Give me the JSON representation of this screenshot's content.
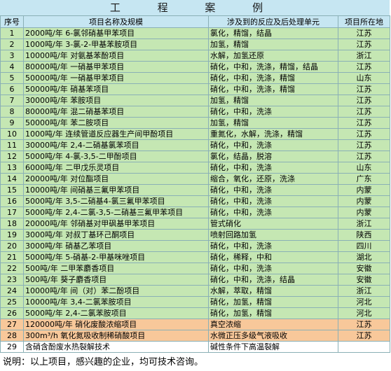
{
  "title": "工 程 案 例",
  "headers": {
    "no": "序号",
    "name": "项目名称及规模",
    "process": "涉及到的反应及后处理单元",
    "region": "项目所在地"
  },
  "rows": [
    {
      "no": "1",
      "name": "2000吨/年 6-氯邻硝基甲苯项目",
      "process": "氯化，精馏，结晶",
      "region": "江苏",
      "color": "green"
    },
    {
      "no": "2",
      "name": "1000吨/年  3-氯-2-甲基苯胺项目",
      "process": "加氢，精馏",
      "region": "江苏",
      "color": "green"
    },
    {
      "no": "3",
      "name": "10000吨/年 对氨基苯酚项目",
      "process": "水解，加氢还原",
      "region": "浙江",
      "color": "green"
    },
    {
      "no": "4",
      "name": "80000吨/年 一硝基甲苯项目",
      "process": "硝化，中和，洗涤，精馏，结晶",
      "region": "江苏",
      "color": "green"
    },
    {
      "no": "5",
      "name": "50000吨/年 一硝基甲苯项目",
      "process": "硝化，中和，洗涤，精馏",
      "region": "山东",
      "color": "green"
    },
    {
      "no": "6",
      "name": "50000吨/年 硝基苯项目",
      "process": "硝化，中和，洗涤，精馏",
      "region": "江苏",
      "color": "green"
    },
    {
      "no": "7",
      "name": "30000吨/年 苯胺项目",
      "process": "加氢，精馏",
      "region": "江苏",
      "color": "green"
    },
    {
      "no": "8",
      "name": "80000吨/年 混二硝基苯项目",
      "process": "硝化，中和，洗涤",
      "region": "江苏",
      "color": "green"
    },
    {
      "no": "9",
      "name": "50000吨/年 苯二胺项目",
      "process": "加氢，精馏",
      "region": "江苏",
      "color": "green"
    },
    {
      "no": "10",
      "name": "1000吨/年 连续管道反应器生产间甲酚项目",
      "process": "重氮化，水解，洗涤，精馏",
      "region": "江苏",
      "color": "green"
    },
    {
      "no": "11",
      "name": "30000吨/年 2,4-二硝基氯苯项目",
      "process": "硝化，中和，洗涤",
      "region": "江苏",
      "color": "green"
    },
    {
      "no": "12",
      "name": "5000吨/年 4-氯-3,5-二甲酚项目",
      "process": "氯化，结晶，脱溶",
      "region": "江苏",
      "color": "green"
    },
    {
      "no": "13",
      "name": "6000吨/年 二甲戊乐灵项目",
      "process": "硝化，中和，洗涤",
      "region": "山东",
      "color": "green"
    },
    {
      "no": "14",
      "name": "20000吨/年 对位酯项目",
      "process": "缩合，氧化，还原，洗涤",
      "region": "广东",
      "color": "green"
    },
    {
      "no": "15",
      "name": "10000吨/年 间硝基三氟甲苯项目",
      "process": "硝化，中和，洗涤",
      "region": "内蒙",
      "color": "green"
    },
    {
      "no": "16",
      "name": "5000吨/年 3,5-二硝基4-氯三氟甲苯项目",
      "process": "硝化，中和，洗涤",
      "region": "内蒙",
      "color": "green"
    },
    {
      "no": "17",
      "name": "5000吨/年 2,4-二氯-3,5-二硝基三氟甲苯项目",
      "process": "硝化，中和，洗涤",
      "region": "内蒙",
      "color": "green"
    },
    {
      "no": "18",
      "name": "20000吨/年 邻硝基对甲砜基甲苯项目",
      "process": "管式硝化",
      "region": "浙江",
      "color": "green"
    },
    {
      "no": "19",
      "name": "3000吨/年 对叔丁基环己酮项目",
      "process": "喷射回路加氢",
      "region": "陕西",
      "color": "green"
    },
    {
      "no": "20",
      "name": "3000吨/年 硝基乙苯项目",
      "process": "硝化，中和，洗涤",
      "region": "四川",
      "color": "green"
    },
    {
      "no": "21",
      "name": "5000吨/年 5-硝基-2-甲基咪唑项目",
      "process": "硝化，稀释，中和",
      "region": "湖北",
      "color": "green"
    },
    {
      "no": "22",
      "name": "500吨/年 二甲苯麝香项目",
      "process": "硝化，中和，洗涤",
      "region": "安徽",
      "color": "green"
    },
    {
      "no": "23",
      "name": "500吨/年 葵子麝香项目",
      "process": "硝化，中和，洗涤，结晶",
      "region": "安徽",
      "color": "green"
    },
    {
      "no": "24",
      "name": "10000吨/年 间（对）苯二酚项目",
      "process": "水解，萃取，精馏",
      "region": "浙江",
      "color": "green"
    },
    {
      "no": "25",
      "name": "10000吨/年 3,4-二氯苯胺项目",
      "process": "硝化，加氢，精馏",
      "region": "河北",
      "color": "green"
    },
    {
      "no": "26",
      "name": "5000吨/年 2,4-二氯苯胺项目",
      "process": "硝化，加氢，精馏",
      "region": "河北",
      "color": "green"
    },
    {
      "no": "27",
      "name": "120000吨/年 硝化废酸浓缩项目",
      "process": "真空浓缩",
      "region": "江苏",
      "color": "orange"
    },
    {
      "no": "28",
      "name": "300m³/h 氧化氮吸收制稀硝酸项目",
      "process": "水微正压多级气液吸收",
      "region": "江苏",
      "color": "orange"
    },
    {
      "no": "29",
      "name": "含硝含酚废水热裂解技术",
      "process": "碱性条件下高温裂解",
      "region": "",
      "color": "white"
    }
  ],
  "note": "说明：以上项目，感兴趣的企业，均可技术咨询。",
  "colors": {
    "header_bg": "#c6e6f2",
    "green_row": "#c5e7b3",
    "orange_row": "#f8c89a",
    "grid": "#8ab0b6"
  }
}
